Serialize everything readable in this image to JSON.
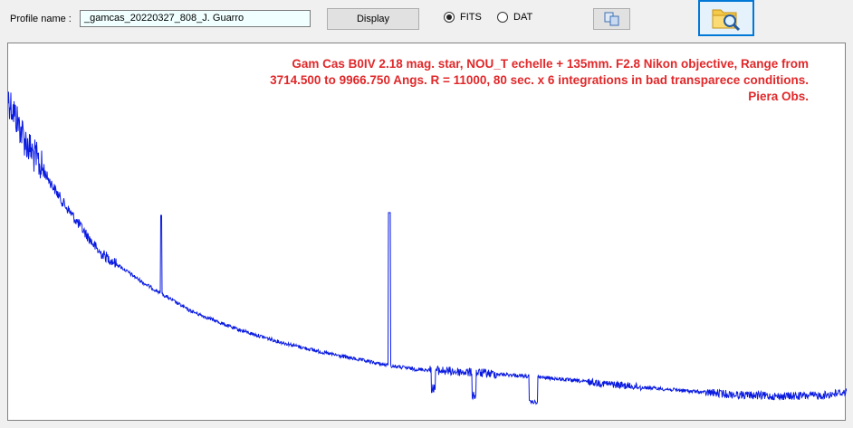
{
  "toolbar": {
    "profile_label": "Profile name :",
    "profile_value": "_gamcas_20220327_808_J. Guarro",
    "display_label": "Display",
    "radio_fits": "FITS",
    "radio_dat": "DAT",
    "selected_format": "FITS",
    "copy_icon": "copy-icon",
    "open_icon": "folder-search-icon"
  },
  "chart_data": {
    "type": "line",
    "title_lines": [
      "Gam Cas  B0IV  2.18 mag. star, NOU_T echelle + 135mm. F2.8 Nikon objective, Range from",
      "3714.500 to 9966.750 Angs. R = 11000,  80 sec. x 6 integrations in bad transparece conditions.",
      "Piera Obs."
    ],
    "x_range": [
      3714.5,
      9966.75
    ],
    "axes_visible": false,
    "grid": false,
    "series_color": "#0a1be0",
    "annotation_color": "#e0282a",
    "emission_lines": [
      4861,
      6563
    ]
  }
}
